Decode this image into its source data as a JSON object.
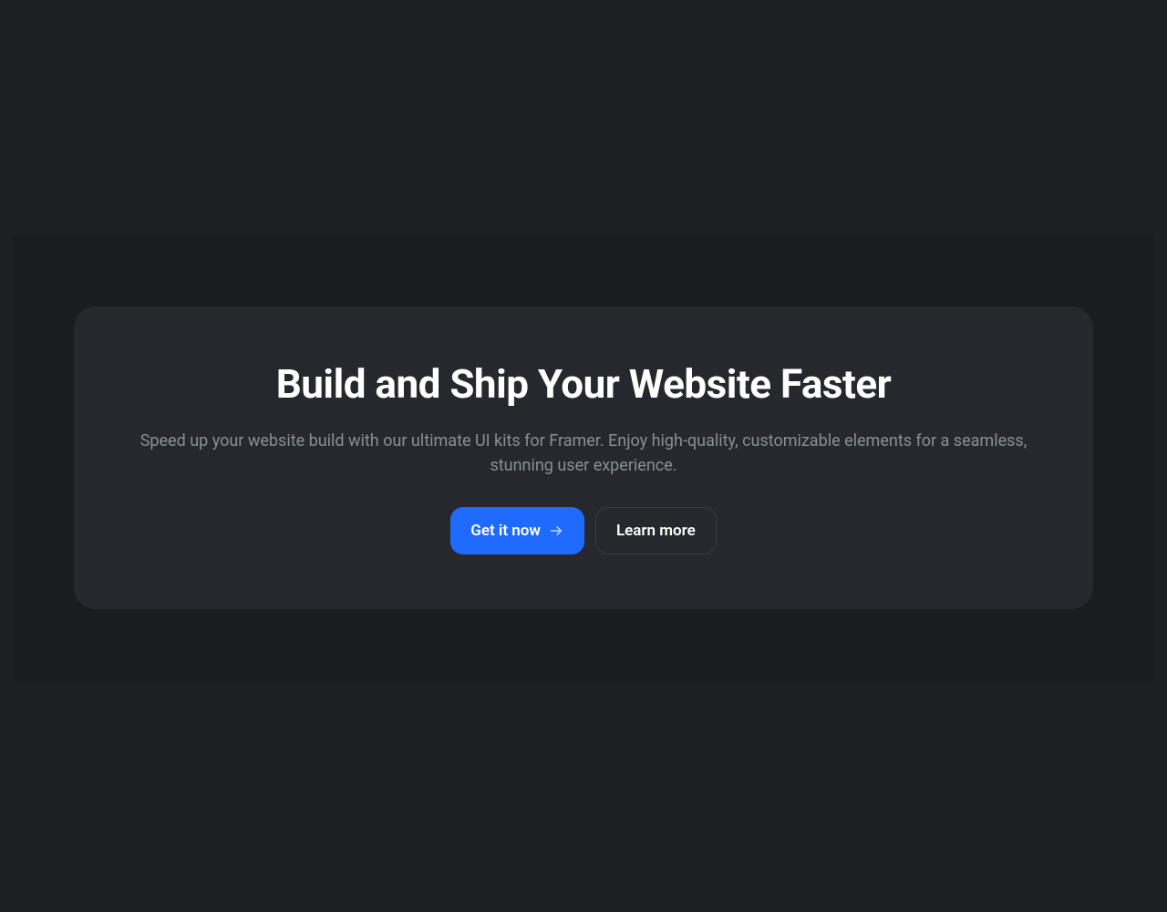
{
  "hero": {
    "heading": "Build and Ship Your Website Faster",
    "subheading": "Speed up your website build with our ultimate UI kits for Framer. Enjoy high-quality, customizable elements for a seamless, stunning user experience.",
    "primary_button_label": "Get it now",
    "secondary_button_label": "Learn more"
  },
  "colors": {
    "background": "#1d1f23",
    "card": "#26282d",
    "primary_button": "#1f6bff",
    "text_muted": "#8a8e97"
  },
  "icons": {
    "arrow_right": "arrow-right-icon"
  }
}
